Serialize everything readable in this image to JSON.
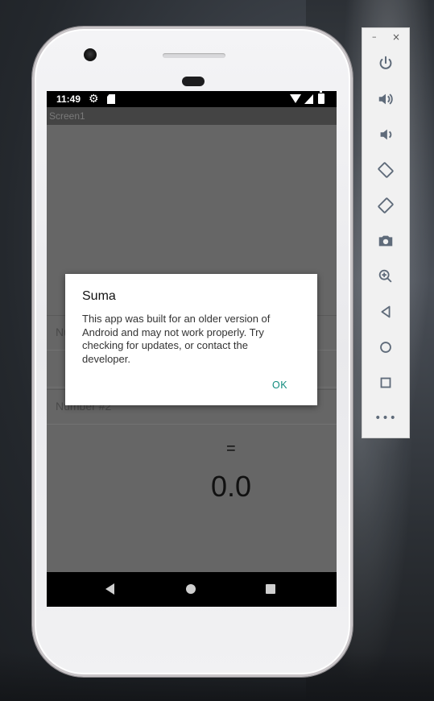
{
  "statusbar": {
    "time": "11:49",
    "icons": [
      "gear-icon",
      "sd-card-icon",
      "wifi-icon",
      "signal-icon",
      "battery-icon"
    ]
  },
  "app": {
    "title": "Screen1",
    "field1_hint": "Number #1",
    "field2_hint": "Number #2",
    "equals": "=",
    "result": "0.0"
  },
  "dialog": {
    "title": "Suma",
    "message": "This app was built for an older version of Android and may not work properly. Try checking for updates, or contact the developer.",
    "ok_label": "OK"
  },
  "emulator_toolbar": {
    "minimize": "–",
    "close": "×",
    "buttons": [
      "power",
      "volume-up",
      "volume-down",
      "rotate-left",
      "rotate-right",
      "screenshot",
      "zoom",
      "back",
      "home",
      "overview",
      "more"
    ],
    "more_label": "•••"
  },
  "colors": {
    "screen_bg": "#666666",
    "dialog_button": "#128c7e"
  }
}
